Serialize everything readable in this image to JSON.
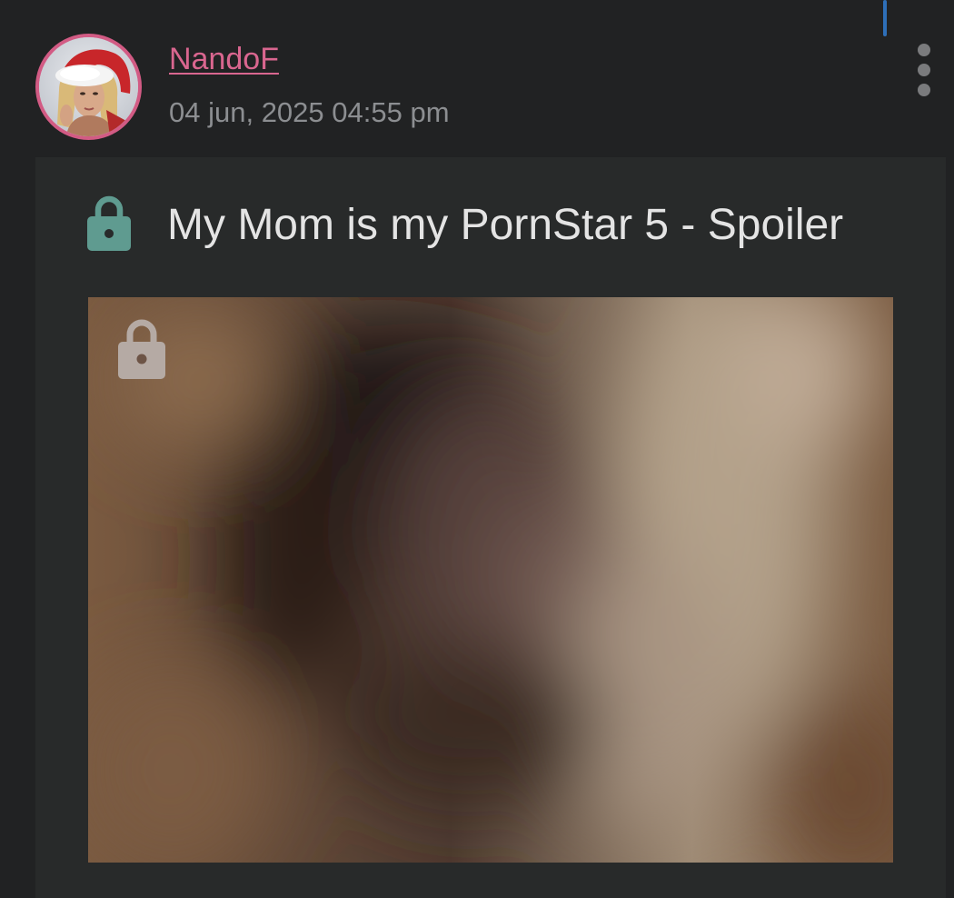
{
  "post": {
    "author": "NandoF",
    "timestamp": "04 jun, 2025 04:55 pm",
    "title": "My Mom is my PornStar 5 - Spoiler"
  },
  "icons": {
    "title": "lock-icon",
    "media": "lock-icon",
    "menu": "more-vertical-icon"
  },
  "colors": {
    "author": "#d9668f",
    "avatar_ring": "#d25b84",
    "title_lock": "#5f9b90",
    "media_lock": "#b5aaa4",
    "background": "#212223",
    "card": "#282a2a"
  }
}
